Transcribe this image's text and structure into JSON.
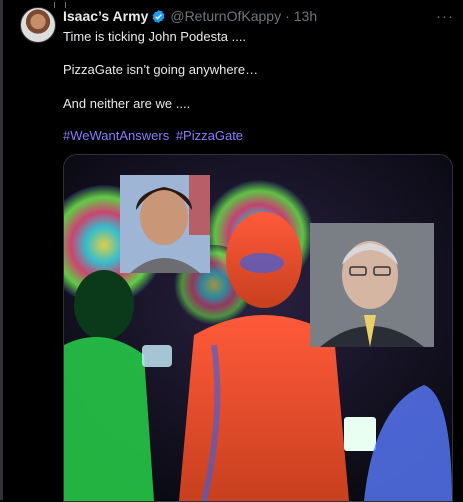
{
  "repost_banner": {
    "icon": "repost-icon"
  },
  "tweet": {
    "author_name": "Isaac’s Army",
    "verified_icon": "verified-badge-icon",
    "handle": "@ReturnOfKappy",
    "separator": "·",
    "time": "13h",
    "more_label": "···",
    "lines": [
      "Time is ticking John Podesta ....",
      "PizzaGate isn’t going anywhere…",
      "And neither are we ...."
    ],
    "hashtags": [
      "#WeWantAnswers",
      "#PizzaGate"
    ],
    "accent_color": "#8b7cff",
    "verified_color": "#1d9bf0"
  }
}
